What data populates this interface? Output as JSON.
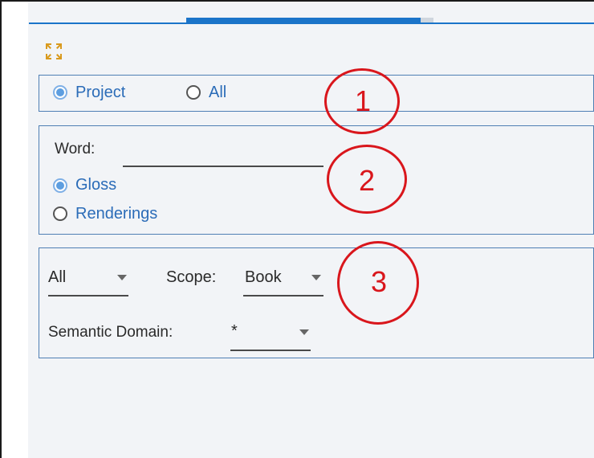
{
  "scope_filter": {
    "options": [
      {
        "label": "Project",
        "selected": true
      },
      {
        "label": "All",
        "selected": false
      }
    ]
  },
  "word_filter": {
    "word_label": "Word:",
    "word_value": "",
    "match_options": [
      {
        "label": "Gloss",
        "selected": true
      },
      {
        "label": "Renderings",
        "selected": false
      }
    ]
  },
  "dropdowns": {
    "category": {
      "value": "All"
    },
    "scope": {
      "label": "Scope:",
      "value": "Book"
    },
    "semantic_domain": {
      "label": "Semantic Domain:",
      "value": "*"
    }
  },
  "callouts": [
    "1",
    "2",
    "3"
  ],
  "icons": {
    "expand": "expand-icon"
  },
  "colors": {
    "accent": "#1b74c9",
    "panel_border": "#4f7fb4",
    "label_blue": "#2b6cb8",
    "callout_red": "#d9161c"
  }
}
